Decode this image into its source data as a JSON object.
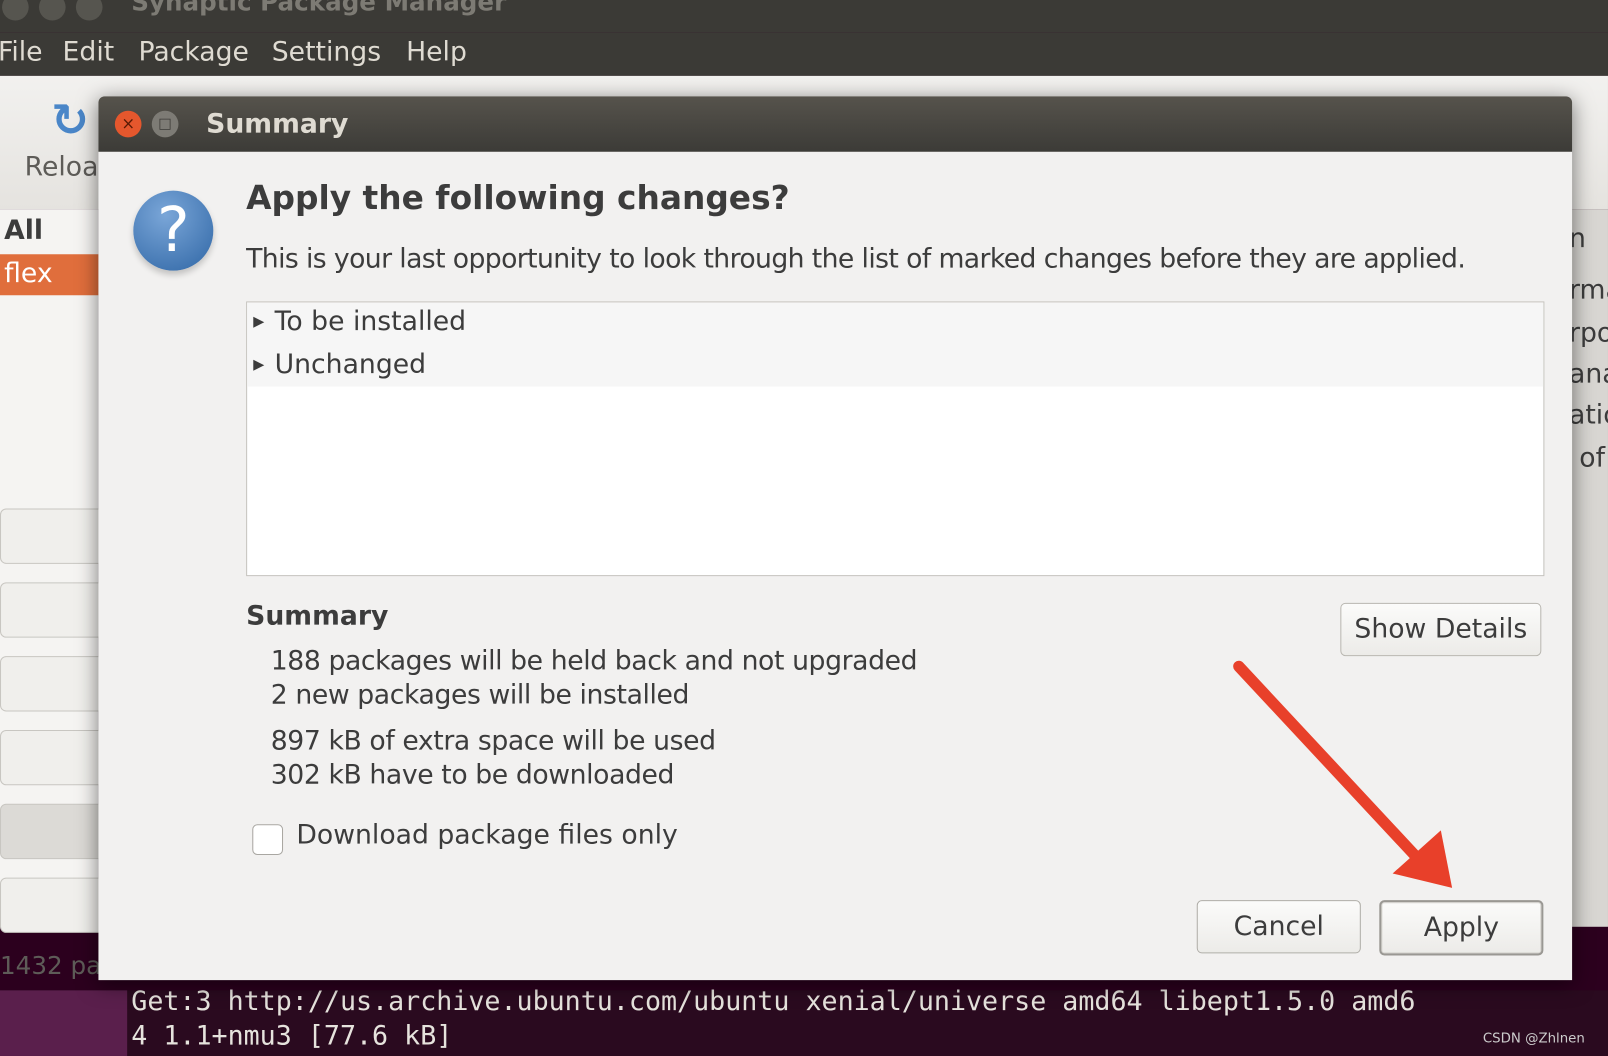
{
  "app": {
    "title": "Synaptic Package Manager",
    "menu": [
      "File",
      "Edit",
      "Package",
      "Settings",
      "Help"
    ],
    "toolbar_reload": "Reloa",
    "filters": {
      "all": "All",
      "selected": "flex"
    },
    "status": "1432 pa",
    "right_column_fragments": [
      "n",
      "rma",
      "rpo",
      "ana",
      "atic",
      "of"
    ]
  },
  "dialog": {
    "title": "Summary",
    "icon": "question-icon",
    "heading": "Apply the following changes?",
    "subtext": "This is your last opportunity to look through the list of marked changes before they are applied.",
    "tree": [
      "To be installed",
      "Unchanged"
    ],
    "summary_label": "Summary",
    "summary_lines": [
      "188 packages will be held back and not upgraded",
      "2 new packages will be installed",
      "897 kB of extra space will be used",
      "302 kB have to be downloaded"
    ],
    "show_details": "Show Details",
    "download_only": {
      "label": "Download package files only",
      "checked": false
    },
    "cancel": "Cancel",
    "apply": "Apply"
  },
  "terminal": {
    "lines": [
      "Get:3 http://us.archive.ubuntu.com/ubuntu xenial/universe amd64 libept1.5.0 amd6",
      "4 1.1+nmu3 [77.6 kB]"
    ]
  },
  "watermark": "CSDN @Zhlnen",
  "colors": {
    "accent": "#e06e3c",
    "arrow": "#e8402a",
    "close": "#e5572d"
  }
}
